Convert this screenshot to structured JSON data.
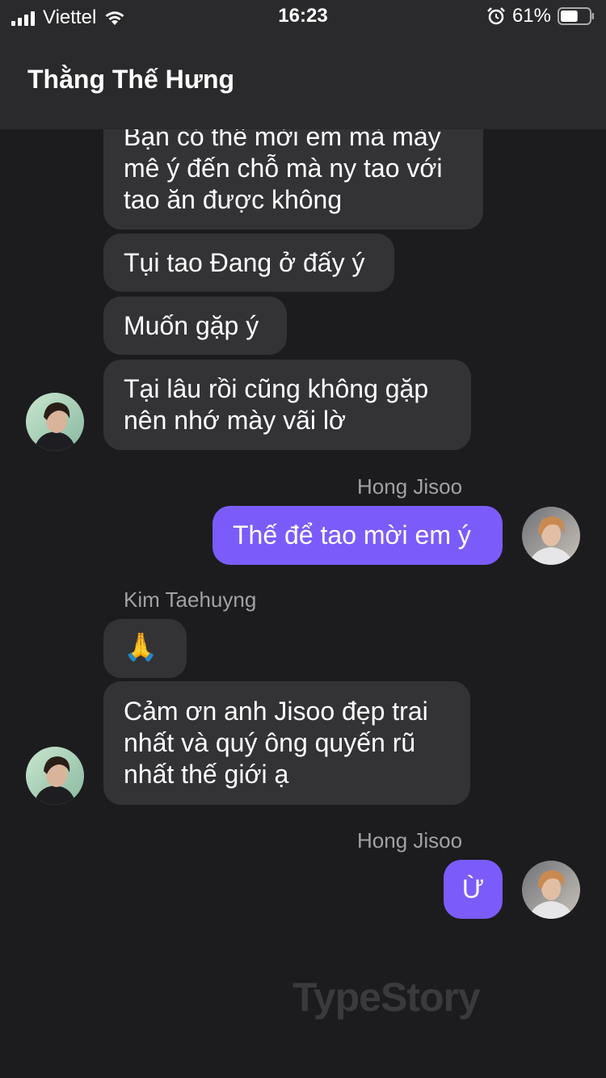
{
  "status_bar": {
    "carrier": "Viettel",
    "time": "16:23",
    "battery_percent": "61%",
    "battery_level": 0.61,
    "icons": [
      "signal-icon",
      "wifi-icon",
      "alarm-icon",
      "battery-icon"
    ]
  },
  "header": {
    "title": "Thằng Thế Hưng"
  },
  "messages": [
    {
      "direction": "incoming",
      "lines": [
        "Bạn có thể mời em mà mày",
        "mê ý đến chỗ mà ny tao với",
        "tao ăn được không"
      ]
    },
    {
      "direction": "incoming",
      "lines": [
        "Tụi tao Đang ở đấy ý"
      ]
    },
    {
      "direction": "incoming",
      "lines": [
        "Muốn gặp ý"
      ]
    },
    {
      "direction": "incoming",
      "lines": [
        "Tại lâu rồi cũng không gặp",
        "nên nhớ mày vãi lờ"
      ]
    },
    {
      "direction": "outgoing",
      "sender": "Hong Jisoo",
      "lines": [
        "Thế để tao mời em ý"
      ]
    },
    {
      "direction": "incoming",
      "sender": "Kim Taehuyng",
      "lines": [
        "🙏"
      ]
    },
    {
      "direction": "incoming",
      "lines": [
        "Cảm ơn anh Jisoo đẹp trai",
        "nhất và quý ông quyến rũ",
        "nhất thế giới ạ"
      ]
    },
    {
      "direction": "outgoing",
      "sender": "Hong Jisoo",
      "lines": [
        "Ừ"
      ]
    }
  ],
  "watermark": "TypeStory",
  "colors": {
    "background": "#1c1c1e",
    "header": "#2a2a2c",
    "incoming_bubble": "#333336",
    "outgoing_bubble": "#7b5cfa",
    "sender_name": "#a1a1a6"
  }
}
